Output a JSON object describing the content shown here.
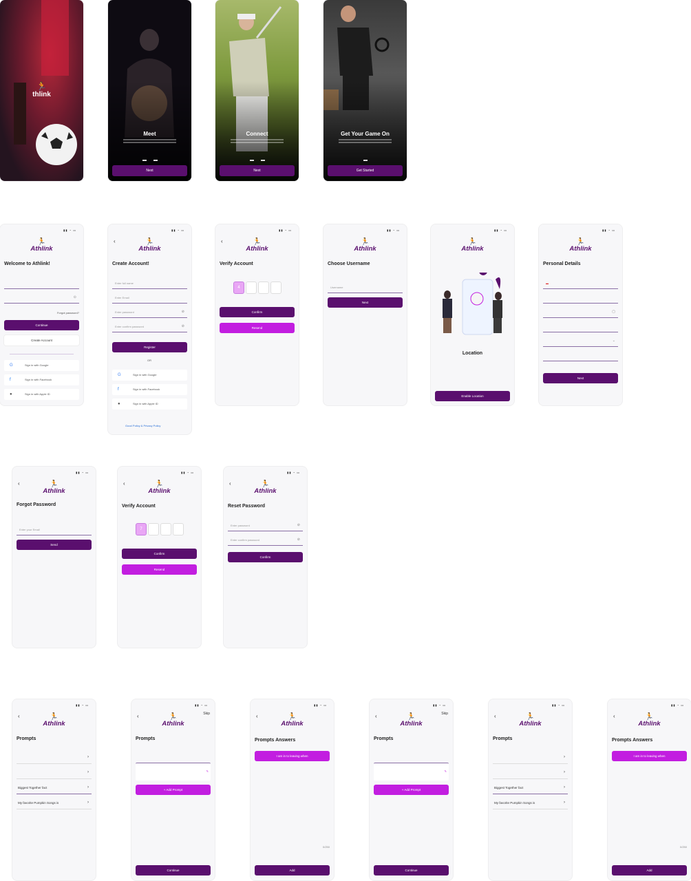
{
  "brand": {
    "name": "thlink",
    "logo_name": "Athlink",
    "primary": "#5a0f6e",
    "accent": "#c21ee0"
  },
  "onboarding": [
    {
      "title": "",
      "button": ""
    },
    {
      "title": "Meet",
      "button": "Next"
    },
    {
      "title": "Connect",
      "button": "Next"
    },
    {
      "title": "Get Your Game On",
      "button": "Get Started"
    }
  ],
  "login": {
    "title": "Welcome to Athlink!",
    "forgot": "Forgot password?",
    "continue": "Continue",
    "create": "Create Account",
    "social": [
      "Sign in with Google",
      "Sign in with Facebook",
      "Sign in with Apple ID"
    ]
  },
  "create_account": {
    "title": "Create Account!",
    "fields": [
      "Enter full name",
      "Enter Email",
      "Enter password",
      "Enter confirm password"
    ],
    "register": "Register",
    "or": "OR",
    "social": [
      "Sign in with Google",
      "Sign in with Facebook",
      "Sign in with Apple ID"
    ],
    "terms_link": "Good Policy & Privacy Policy"
  },
  "verify": {
    "title": "Verify Account",
    "code_digit": "4",
    "confirm": "Confirm",
    "resend": "Resend"
  },
  "username": {
    "title": "Choose Username",
    "field": "Username",
    "button": "Next"
  },
  "location": {
    "title": "Location",
    "button": "Enable Location"
  },
  "personal": {
    "title": "Personal Details",
    "button": "Next"
  },
  "forgot": {
    "title": "Forgot Password",
    "field": "Enter your Email",
    "button": "Send"
  },
  "verify2": {
    "title": "Verify Account",
    "code_digit": "7",
    "confirm": "Confirm",
    "resend": "Resend"
  },
  "reset": {
    "title": "Reset Password",
    "fields": [
      "Enter password",
      "Enter confirm password"
    ],
    "button": "Confirm"
  },
  "prompts": {
    "title": "Prompts",
    "rows": [
      "My favorite Pumpkin Songs is"
    ],
    "row_next": "Biggest Together fact",
    "continue": "Continue",
    "add_prompt": "+ Add Prompt",
    "skip": "Skip"
  },
  "prompts_answers": {
    "title": "Prompts Answers",
    "chip": "I am in to leaving when",
    "counter": "0/250",
    "add": "Add"
  }
}
